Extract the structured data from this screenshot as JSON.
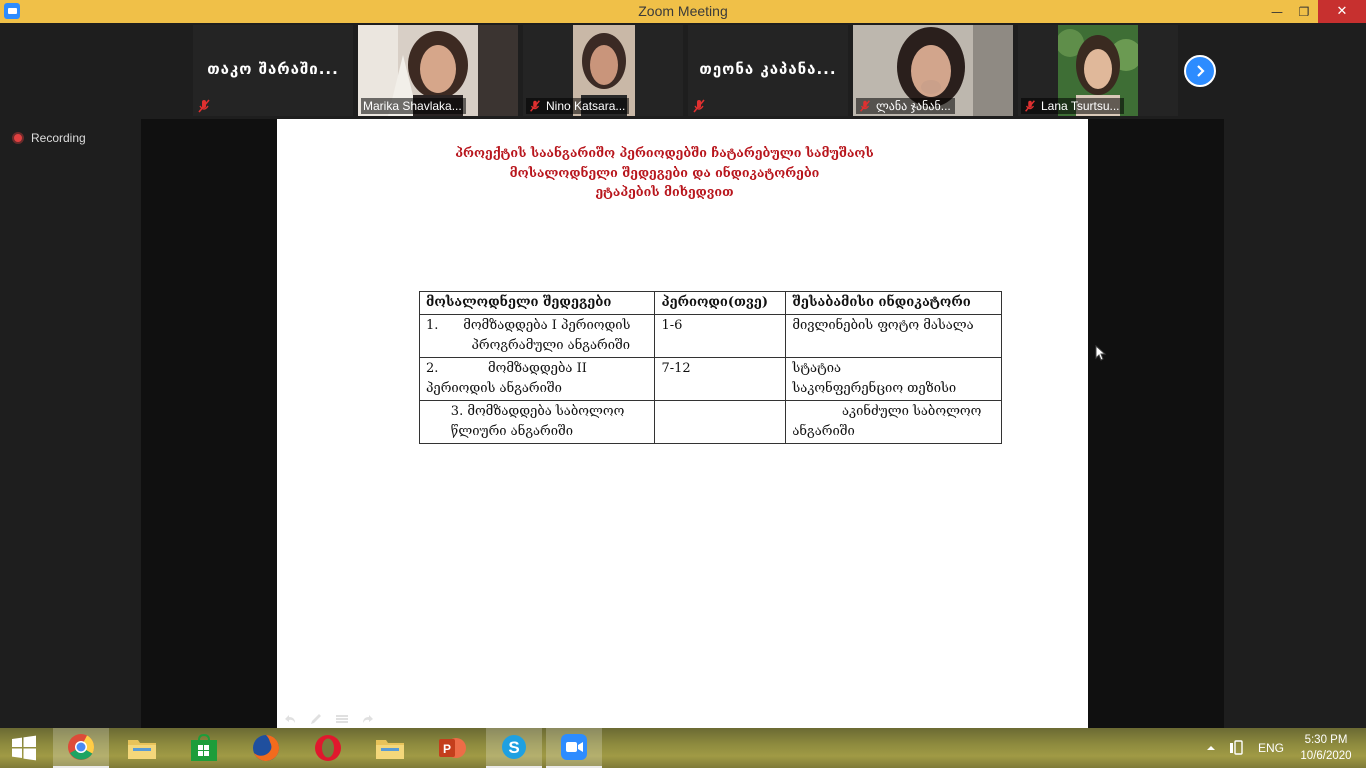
{
  "window": {
    "title": "Zoom Meeting",
    "minimize": "—",
    "maximize": "❐",
    "close": "✕"
  },
  "participants": [
    {
      "name": "თაკო შარაში...",
      "video": false
    },
    {
      "name": "Marika Shavlaka...",
      "video": true,
      "active": true
    },
    {
      "name": "Nino Katsara...",
      "video": true
    },
    {
      "name": "თეონა კაპანა...",
      "video": false
    },
    {
      "name": "ლანა ჯანან...",
      "video": true
    },
    {
      "name": "Lana Tsurtsu...",
      "video": true
    }
  ],
  "recording": {
    "label": "Recording"
  },
  "slide": {
    "title_lines": [
      "პროექტის საანგარიშო პერიოდებში ჩატარებული სამუშაოს",
      "მოსალოდნელი შედეგები და ინდიკატორები",
      "ეტაპების მიხედვით"
    ],
    "table": {
      "headers": [
        "მოსალოდნელი შედეგები",
        "პერიოდი(თვე)",
        "შესაბამისი ინდიკატორი"
      ],
      "rows": [
        [
          "1.      მომზადდება I პერიოდის\n           პროგრამული ანგარიში",
          "1-6",
          "მივლინების ფოტო მასალა"
        ],
        [
          "2.            მომზადდება II\nპერიოდის ანგარიში",
          "7-12",
          "სტატია\nსაკონფერენციო თეზისი"
        ],
        [
          "      3. მომზადდება საბოლოო\n      წლიური ანგარიში",
          "",
          "            აკინძული საბოლოო\nანგარიში"
        ]
      ]
    }
  },
  "taskbar": {
    "apps": [
      "start",
      "chrome",
      "file-explorer",
      "store",
      "firefox",
      "opera",
      "file-explorer-2",
      "powerpoint",
      "skype",
      "zoom"
    ],
    "language": "ENG",
    "time": "5:30 PM",
    "date": "10/6/2020"
  }
}
